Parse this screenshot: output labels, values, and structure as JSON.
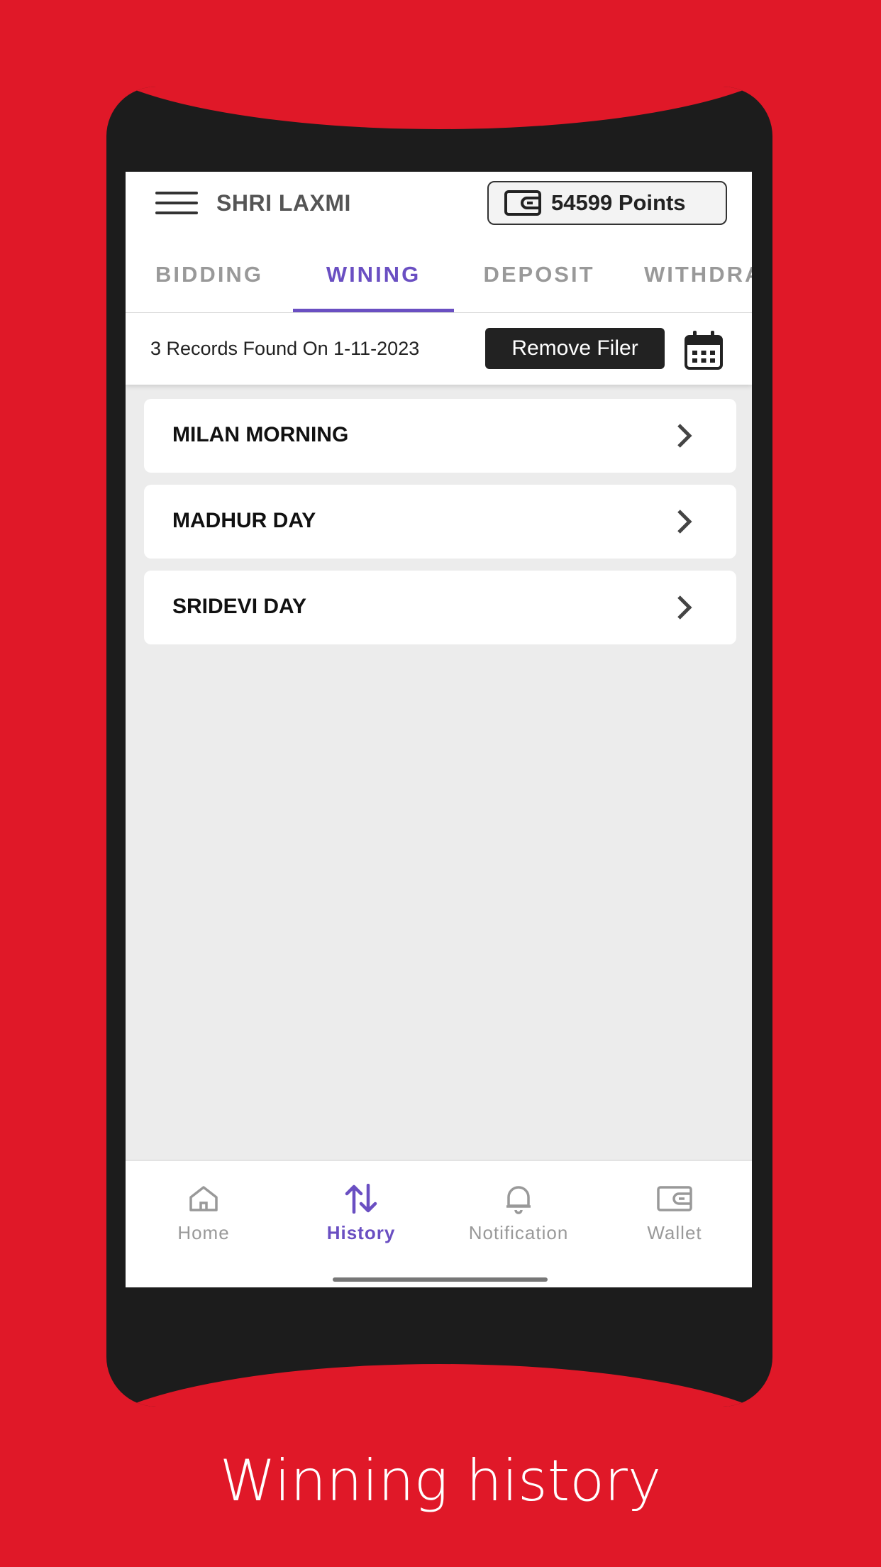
{
  "header": {
    "title": "SHRI LAXMI",
    "points": "54599 Points"
  },
  "tabs": [
    {
      "label": "BIDDING"
    },
    {
      "label": "WINING"
    },
    {
      "label": "DEPOSIT"
    },
    {
      "label": "WITHDRAW"
    }
  ],
  "filter": {
    "records_text": "3 Records Found On 1-11-2023",
    "remove_label": "Remove Filer"
  },
  "list": [
    {
      "label": "MILAN MORNING"
    },
    {
      "label": "MADHUR DAY"
    },
    {
      "label": "SRIDEVI DAY"
    }
  ],
  "bottom_nav": [
    {
      "label": "Home",
      "icon": "home-icon"
    },
    {
      "label": "History",
      "icon": "history-icon"
    },
    {
      "label": "Notification",
      "icon": "bell-icon"
    },
    {
      "label": "Wallet",
      "icon": "wallet-icon"
    }
  ],
  "caption": "Winning history",
  "colors": {
    "brand_red": "#E01828",
    "accent": "#6A4FC2"
  }
}
